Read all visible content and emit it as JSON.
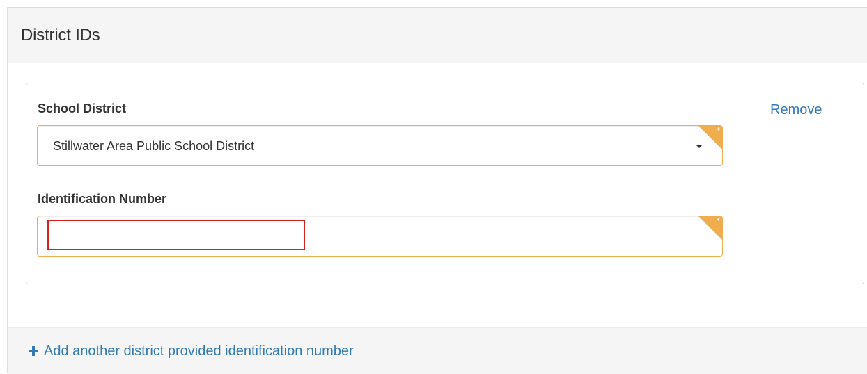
{
  "panel": {
    "title": "District IDs"
  },
  "district_entry": {
    "school_district": {
      "label": "School District",
      "selected_value": "Stillwater Area Public School District",
      "required_marker": "*"
    },
    "identification_number": {
      "label": "Identification Number",
      "value": "",
      "placeholder": "",
      "required_marker": "*"
    },
    "remove_label": "Remove"
  },
  "footer": {
    "add_label": "Add another district provided identification number"
  },
  "colors": {
    "link": "#337ab7",
    "required_accent": "#f0ad4e",
    "focus_highlight": "#d9201c",
    "panel_background": "#f5f5f5"
  },
  "icons": {
    "select_caret": "caret-down-icon",
    "required": "star-icon",
    "add": "plus-icon"
  }
}
